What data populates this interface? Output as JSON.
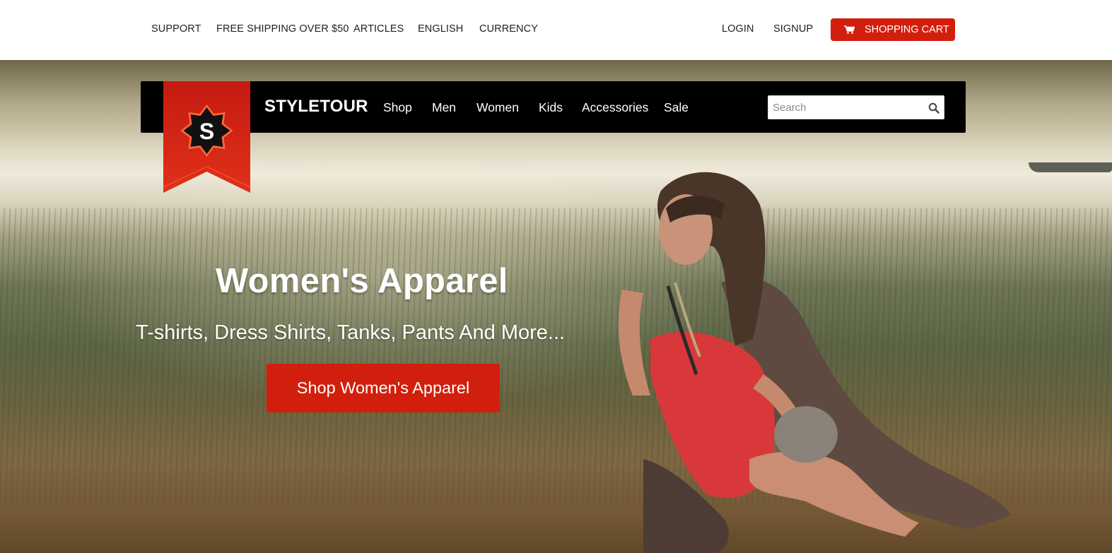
{
  "topbar": {
    "left_links": [
      "SUPPORT",
      "FREE SHIPPING OVER $50",
      "ARTICLES",
      "ENGLISH",
      "CURRENCY"
    ],
    "right_links": [
      "LOGIN",
      "SIGNUP"
    ],
    "cart_label": "SHOPPING CART",
    "cart_icon": "shopping-cart-icon"
  },
  "navbar": {
    "logo_letter": "S",
    "brand": "STYLETOUR",
    "items": [
      "Shop",
      "Men",
      "Women",
      "Kids",
      "Accessories",
      "Sale"
    ],
    "search_placeholder": "Search",
    "search_icon": "search-icon"
  },
  "hero": {
    "title": "Women's Apparel",
    "subtitle": "T-shirts, Dress Shirts, Tanks, Pants And More...",
    "cta_label": "Shop Women's Apparel"
  },
  "colors": {
    "accent": "#d21f0d",
    "navbar": "#000000",
    "text_dark": "#222222"
  }
}
